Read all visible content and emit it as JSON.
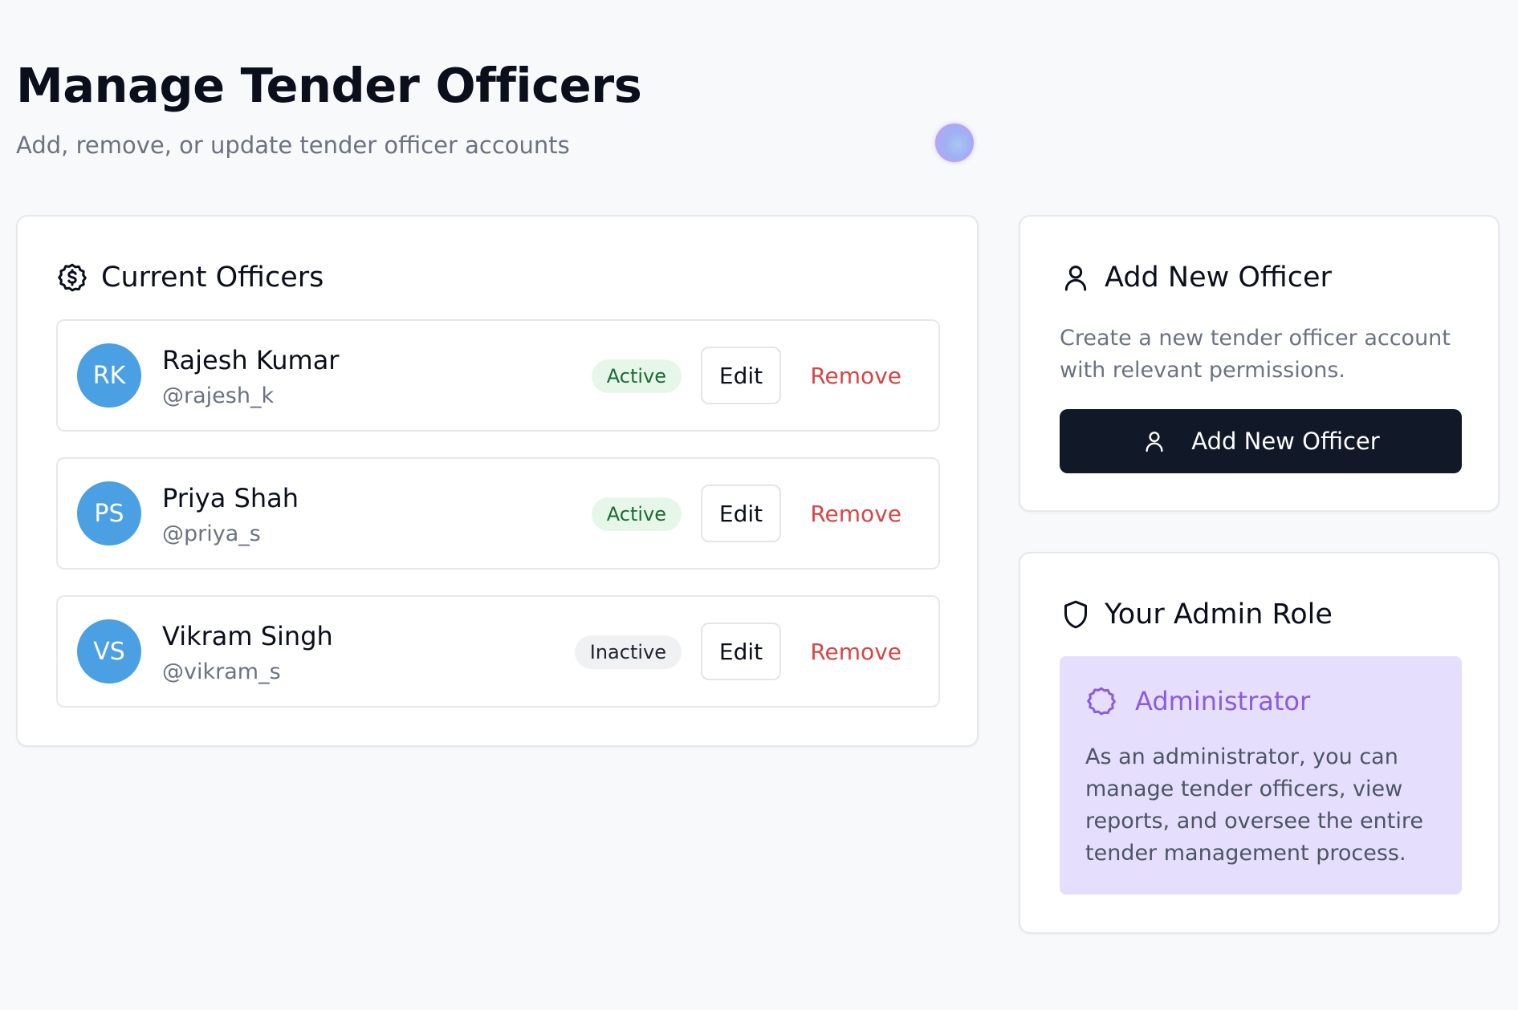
{
  "header": {
    "title": "Manage Tender Officers",
    "subtitle": "Add, remove, or update tender officer accounts"
  },
  "officers_card": {
    "title": "Current Officers",
    "icon": "dollar-circle-icon",
    "edit_label": "Edit",
    "remove_label": "Remove",
    "officers": [
      {
        "initials": "RK",
        "name": "Rajesh Kumar",
        "handle": "@rajesh_k",
        "status": "Active"
      },
      {
        "initials": "PS",
        "name": "Priya Shah",
        "handle": "@priya_s",
        "status": "Active"
      },
      {
        "initials": "VS",
        "name": "Vikram Singh",
        "handle": "@vikram_s",
        "status": "Inactive"
      }
    ]
  },
  "add_card": {
    "title": "Add New Officer",
    "icon": "user-icon",
    "description": "Create a new tender officer account with relevant permissions.",
    "button_label": "Add New Officer"
  },
  "role_card": {
    "title": "Your Admin Role",
    "icon": "shield-icon",
    "role_name": "Administrator",
    "role_icon": "badge-icon",
    "role_description": "As an administrator, you can manage tender officers, view reports, and oversee the entire tender management process."
  },
  "colors": {
    "background": "#f8f9fb",
    "avatar": "#4aa0e2",
    "active_badge_bg": "#e6f7ea",
    "active_badge_text": "#1b6b34",
    "inactive_badge_bg": "#f0f1f3",
    "remove_text": "#d64545",
    "primary_button": "#111827",
    "role_box_bg": "#e5defc",
    "role_accent": "#8b5be0"
  }
}
